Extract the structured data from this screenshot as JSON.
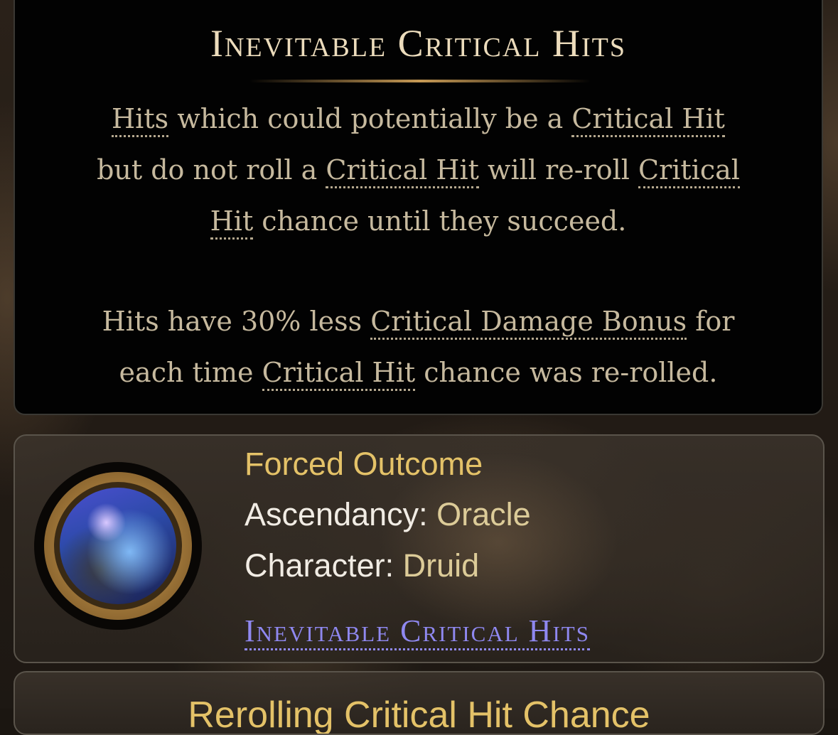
{
  "tooltip": {
    "title": "Inevitable Critical Hits",
    "paragraph1": [
      [
        "Hits",
        " which could potentially be a ",
        "Critical Hit"
      ],
      [
        "but do not roll a ",
        "Critical Hit",
        " will re-roll ",
        "Critical"
      ],
      [
        "Hit",
        " chance until they succeed."
      ]
    ],
    "p1": {
      "l1a": "Hits",
      "l1b": " which could potentially be a ",
      "l1c": "Critical Hit",
      "l2a": "but do not roll a ",
      "l2b": "Critical Hit",
      "l2c": " will re-roll ",
      "l2d": "Critical",
      "l3a": "Hit",
      "l3b": " chance until they succeed."
    },
    "p2": {
      "l1a": "Hits have 30% less ",
      "l1b": "Critical Damage Bonus",
      "l1c": " for",
      "l2a": "each time ",
      "l2b": "Critical Hit",
      "l2c": " chance was re-rolled."
    }
  },
  "node": {
    "name": "Forced Outcome",
    "ascendancy_label": "Ascendancy: ",
    "ascendancy_value": "Oracle",
    "character_label": "Character: ",
    "character_value": "Druid",
    "link_text": "Inevitable Critical Hits",
    "icon": "ascendancy-node-icon"
  },
  "next_card": {
    "title": "Rerolling Critical Hit Chance"
  },
  "colors": {
    "title": "#ecdcbc",
    "description": "#c6b99e",
    "node_name": "#e4c268",
    "link": "#8f88f0"
  }
}
